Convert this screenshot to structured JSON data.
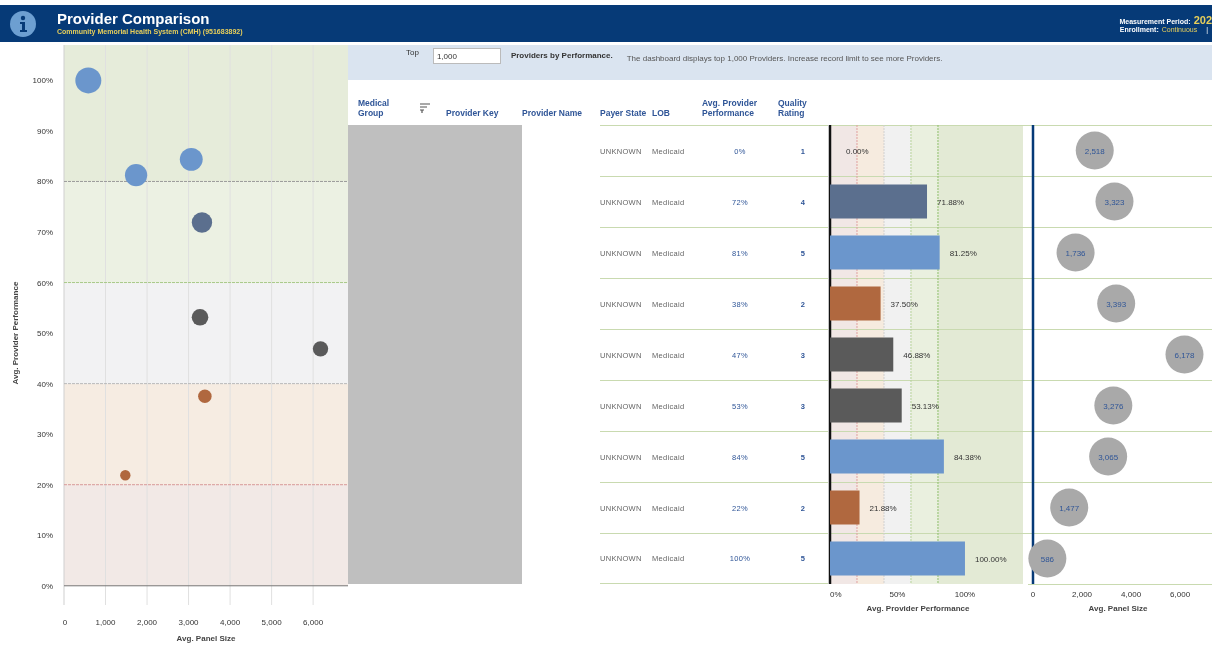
{
  "header": {
    "title": "Provider Comparison",
    "subtitle": "Community Memorial Health System (CMH) (951683892)",
    "measurement_label": "Measurement Period:",
    "measurement_value": "202",
    "enrollment_label": "Enrollment:",
    "enrollment_value": "Continuous",
    "separator": "|"
  },
  "scatter": {
    "chart_data": {
      "type": "scatter",
      "xlabel": "Avg. Panel Size",
      "ylabel": "Avg. Provider Performance",
      "xlim": [
        0,
        6840
      ],
      "ylim": [
        -3.8,
        107
      ],
      "x": [
        586,
        1736,
        3065,
        3323,
        3276,
        6178,
        3393,
        1477
      ],
      "xticks": [
        {
          "value": 0,
          "label": "0"
        },
        {
          "value": 1000,
          "label": "1,000"
        },
        {
          "value": 2000,
          "label": "2,000"
        },
        {
          "value": 3000,
          "label": "3,000"
        },
        {
          "value": 4000,
          "label": "4,000"
        },
        {
          "value": 5000,
          "label": "5,000"
        },
        {
          "value": 6000,
          "label": "6,000"
        }
      ],
      "yticks": [
        {
          "value": 0,
          "label": "0%"
        },
        {
          "value": 10,
          "label": "10%"
        },
        {
          "value": 20,
          "label": "20%"
        },
        {
          "value": 30,
          "label": "30%"
        },
        {
          "value": 40,
          "label": "40%"
        },
        {
          "value": 50,
          "label": "50%"
        },
        {
          "value": 60,
          "label": "60%"
        },
        {
          "value": 70,
          "label": "70%"
        },
        {
          "value": 80,
          "label": "80%"
        },
        {
          "value": 90,
          "label": "90%"
        },
        {
          "value": 100,
          "label": "100%"
        }
      ],
      "grid": true,
      "ref_lines": [
        {
          "axis": "y",
          "value": 80,
          "color": "#9a9a9a"
        },
        {
          "axis": "y",
          "value": 60,
          "color": "#a9c98a"
        },
        {
          "axis": "y",
          "value": 40,
          "color": "#b8b8b8"
        },
        {
          "axis": "y",
          "value": 20,
          "color": "#d99a9a"
        }
      ],
      "series": [
        {
          "color": "#6b96cc",
          "values": [
            100,
            81.25,
            84.38,
            null,
            null,
            null,
            null,
            null
          ]
        },
        {
          "color": "#5b6f8e",
          "values": [
            null,
            null,
            null,
            71.88,
            null,
            null,
            null,
            null
          ]
        },
        {
          "color": "#5a5a5a",
          "values": [
            null,
            null,
            null,
            null,
            53.13,
            46.88,
            null,
            null
          ]
        },
        {
          "color": "#b0683f",
          "values": [
            null,
            null,
            null,
            null,
            null,
            null,
            37.5,
            21.88
          ]
        }
      ]
    }
  },
  "record_limit": {
    "label": "Top",
    "value": "1,000",
    "suffix": "Providers by Performance.",
    "message": "The dashboard displays top 1,000  Providers. Increase record limit to see more Providers."
  },
  "table": {
    "columns": [
      "Medical Group",
      "Provider Key",
      "Provider Name",
      "Payer State",
      "LOB",
      "Avg. Provider Performance",
      "Quality Rating"
    ],
    "rows": [
      {
        "payer_state": "UNKNOWN",
        "lob": "Medicaid",
        "performance": "0%",
        "quality_rating": "1"
      },
      {
        "payer_state": "UNKNOWN",
        "lob": "Medicaid",
        "performance": "72%",
        "quality_rating": "4",
        "color": "#5b6f8e"
      },
      {
        "payer_state": "UNKNOWN",
        "lob": "Medicaid",
        "performance": "81%",
        "quality_rating": "5",
        "color": "#6b96cc"
      },
      {
        "payer_state": "UNKNOWN",
        "lob": "Medicaid",
        "performance": "38%",
        "quality_rating": "2",
        "color": "#b0683f"
      },
      {
        "payer_state": "UNKNOWN",
        "lob": "Medicaid",
        "performance": "47%",
        "quality_rating": "3",
        "color": "#5a5a5a"
      },
      {
        "payer_state": "UNKNOWN",
        "lob": "Medicaid",
        "performance": "53%",
        "quality_rating": "3",
        "color": "#5a5a5a"
      },
      {
        "payer_state": "UNKNOWN",
        "lob": "Medicaid",
        "performance": "84%",
        "quality_rating": "5",
        "color": "#6b96cc"
      },
      {
        "payer_state": "UNKNOWN",
        "lob": "Medicaid",
        "performance": "22%",
        "quality_rating": "2",
        "color": "#b0683f"
      },
      {
        "payer_state": "UNKNOWN",
        "lob": "Medicaid",
        "performance": "100%",
        "quality_rating": "5",
        "color": "#6b96cc"
      }
    ]
  },
  "performance_chart": {
    "chart_data": {
      "type": "bar",
      "orientation": "horizontal",
      "xlabel": "Avg. Provider Performance",
      "xlim": [
        0,
        146.7
      ],
      "ref_lines": [
        {
          "axis": "x",
          "value": 20,
          "color": "#e0a0a0"
        },
        {
          "axis": "x",
          "value": 40,
          "color": "#d0d0d0"
        },
        {
          "axis": "x",
          "value": 60,
          "color": "#b6d39a"
        },
        {
          "axis": "x",
          "value": 80,
          "color": "#8fbf6a"
        }
      ],
      "values": [
        0,
        71.88,
        81.25,
        37.5,
        46.88,
        53.13,
        84.38,
        21.88,
        100
      ],
      "value_labels": [
        "0.00%",
        "71.88%",
        "81.25%",
        "37.50%",
        "46.88%",
        "53.13%",
        "84.38%",
        "21.88%",
        "100.00%"
      ],
      "xticks": [
        {
          "value": 0,
          "label": "0%"
        },
        {
          "value": 50,
          "label": "50%"
        },
        {
          "value": 100,
          "label": "100%"
        }
      ]
    }
  },
  "panel_size_chart": {
    "chart_data": {
      "type": "scatter",
      "orientation": "horizontal",
      "xlabel": "Avg. Panel Size",
      "xlim": [
        0,
        7300
      ],
      "categories": [
        null,
        null,
        null,
        null,
        null,
        null,
        null,
        null,
        null
      ],
      "values": [
        2518,
        3323,
        1736,
        3393,
        6178,
        3276,
        3065,
        1477,
        586
      ],
      "value_labels": [
        "2,518",
        "3,323",
        "1,736",
        "3,393",
        "6,178",
        "3,276",
        "3,065",
        "1,477",
        "586"
      ],
      "xticks": [
        {
          "value": 0,
          "label": "0"
        },
        {
          "value": 2000,
          "label": "2,000"
        },
        {
          "value": 4000,
          "label": "4,000"
        },
        {
          "value": 6000,
          "label": "6,000"
        }
      ]
    }
  }
}
